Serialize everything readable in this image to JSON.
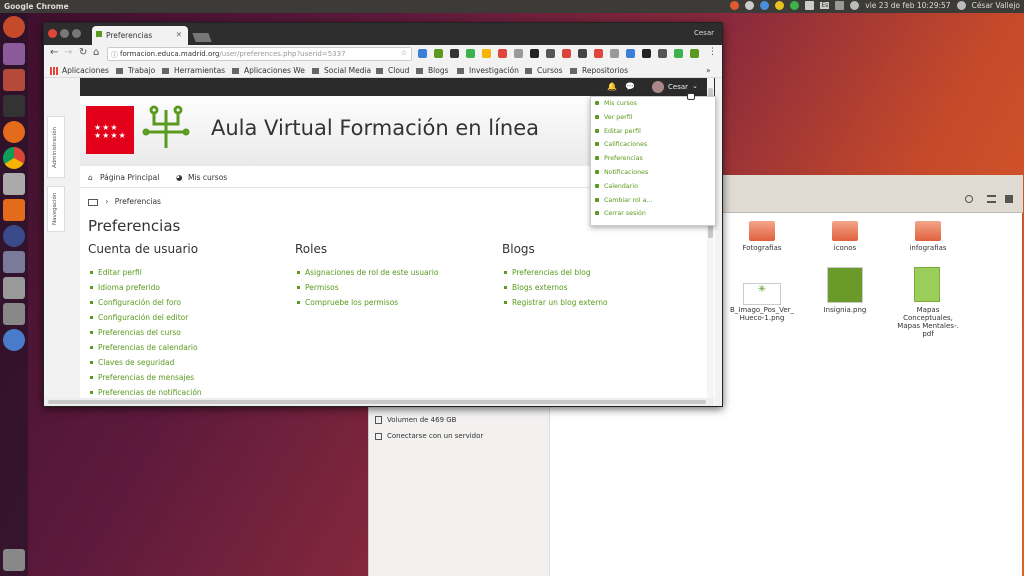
{
  "topbar": {
    "app_name": "Google Chrome",
    "clock": "vie 23 de feb 10:29:57",
    "user": "César Vallejo",
    "keyboard": "Es"
  },
  "file_manager": {
    "items": [
      {
        "name": "Fotografias",
        "type": "folder"
      },
      {
        "name": "iconos",
        "type": "folder"
      },
      {
        "name": "infografias",
        "type": "folder"
      },
      {
        "name": "B_Imago_Pos_Ver_\nHueco-1.png",
        "type": "image"
      },
      {
        "name": "Insignia.png",
        "type": "image"
      },
      {
        "name": "Mapas\nConceptuales,\nMapas Mentales-.\npdf",
        "type": "pdf"
      }
    ],
    "sidebar": {
      "volume": "Volumen de 469 GB",
      "connect": "Conectarse con un servidor"
    }
  },
  "browser": {
    "profile": "Cesar",
    "tab_title": "Preferencias",
    "url_host": "formacion.educa.madrid.org",
    "url_path": "/user/preferences.php?userid=5337",
    "bookmarks": [
      "Aplicaciones",
      "Trabajo",
      "Herramientas",
      "Aplicaciones We",
      "Social Media",
      "Cloud",
      "Blogs",
      "Investigación",
      "Cursos",
      "Repositorios"
    ],
    "more": "»"
  },
  "page": {
    "user_name": "Cesar",
    "site_title": "Aula Virtual Formación en línea",
    "nav": [
      "Página Principal",
      "Mis cursos"
    ],
    "breadcrumb": "Preferencias",
    "title": "Preferencias",
    "dock": [
      "Administración",
      "Navegación"
    ],
    "columns": [
      {
        "heading": "Cuenta de usuario",
        "links": [
          "Editar perfil",
          "Idioma preferido",
          "Configuración del foro",
          "Configuración del editor",
          "Preferencias del curso",
          "Preferencias de calendario",
          "Claves de seguridad",
          "Preferencias de mensajes",
          "Preferencias de notificación"
        ]
      },
      {
        "heading": "Roles",
        "links": [
          "Asignaciones de rol de este usuario",
          "Permisos",
          "Compruebe los permisos"
        ]
      },
      {
        "heading": "Blogs",
        "links": [
          "Preferencias del blog",
          "Blogs externos",
          "Registrar un blog externo"
        ]
      }
    ],
    "user_menu": [
      "Mis cursos",
      "Ver perfil",
      "Editar perfil",
      "Calificaciones",
      "Preferencias",
      "Notificaciones",
      "Calendario",
      "Cambiar rol a...",
      "Cerrar sesión"
    ]
  },
  "colors": {
    "accent": "#5a9a1e",
    "brand_red": "#e2001a"
  }
}
